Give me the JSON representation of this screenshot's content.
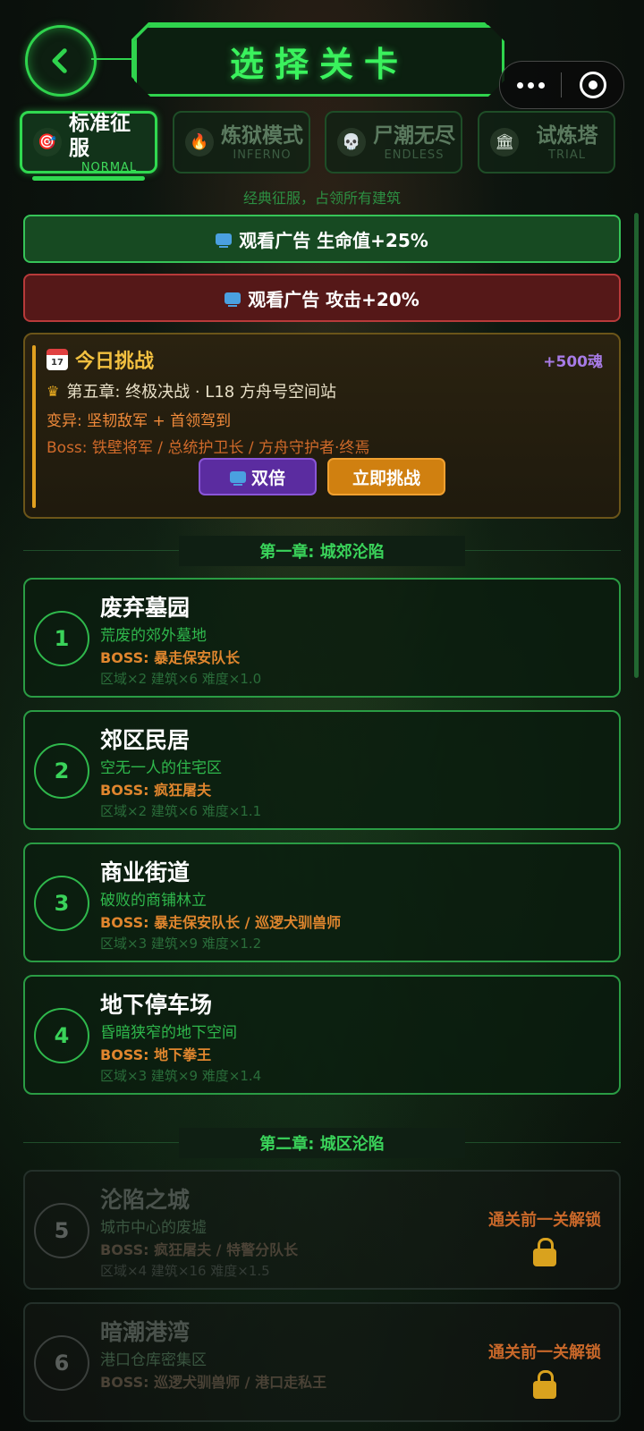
{
  "header": {
    "title": "选择关卡"
  },
  "tabs": [
    {
      "label": "标准征服",
      "sub": "NORMAL",
      "icon": "target-icon",
      "active": true
    },
    {
      "label": "炼狱模式",
      "sub": "INFERNO",
      "icon": "fire-icon",
      "active": false
    },
    {
      "label": "尸潮无尽",
      "sub": "ENDLESS",
      "icon": "skull-icon",
      "active": false
    },
    {
      "label": "试炼塔",
      "sub": "TRIAL",
      "icon": "temple-icon",
      "active": false
    }
  ],
  "mode_description": "经典征服，占领所有建筑",
  "buffs": {
    "hp": "观看广告 生命值+25%",
    "atk": "观看广告 攻击+20%"
  },
  "daily": {
    "title": "今日挑战",
    "calendar_day": "17",
    "reward": "+500魂",
    "stage": "第五章: 终极决战 · L18 方舟号空间站",
    "mutation": "变异: 坚韧敌军 + 首领驾到",
    "boss": "Boss: 铁壁将军 / 总统护卫长 / 方舟守护者·终焉",
    "double_label": "双倍",
    "challenge_label": "立即挑战"
  },
  "chapters": [
    {
      "title": "第一章: 城郊沦陷"
    },
    {
      "title": "第二章: 城区沦陷"
    }
  ],
  "levels": [
    {
      "num": "1",
      "name": "废弃墓园",
      "desc": "荒废的郊外墓地",
      "boss": "BOSS: 暴走保安队长",
      "stats": "区域×2  建筑×6  难度×1.0",
      "locked": false
    },
    {
      "num": "2",
      "name": "郊区民居",
      "desc": "空无一人的住宅区",
      "boss": "BOSS: 疯狂屠夫",
      "stats": "区域×2  建筑×6  难度×1.1",
      "locked": false
    },
    {
      "num": "3",
      "name": "商业街道",
      "desc": "破败的商铺林立",
      "boss": "BOSS: 暴走保安队长 / 巡逻犬驯兽师",
      "stats": "区域×3  建筑×9  难度×1.2",
      "locked": false
    },
    {
      "num": "4",
      "name": "地下停车场",
      "desc": "昏暗狭窄的地下空间",
      "boss": "BOSS: 地下拳王",
      "stats": "区域×3  建筑×9  难度×1.4",
      "locked": false
    },
    {
      "num": "5",
      "name": "沦陷之城",
      "desc": "城市中心的废墟",
      "boss": "BOSS: 疯狂屠夫 / 特警分队长",
      "stats": "区域×4  建筑×16  难度×1.5",
      "locked": true,
      "lock_text": "通关前一关解锁"
    },
    {
      "num": "6",
      "name": "暗潮港湾",
      "desc": "港口仓库密集区",
      "boss": "BOSS: 巡逻犬驯兽师 / 港口走私王",
      "stats": "",
      "locked": true,
      "lock_text": "通关前一关解锁"
    }
  ],
  "colors": {
    "accent": "#30d950",
    "hp_buff": "#174a22",
    "atk_buff": "#551818",
    "gold": "#f2c040",
    "purple": "#5b2ca0"
  }
}
